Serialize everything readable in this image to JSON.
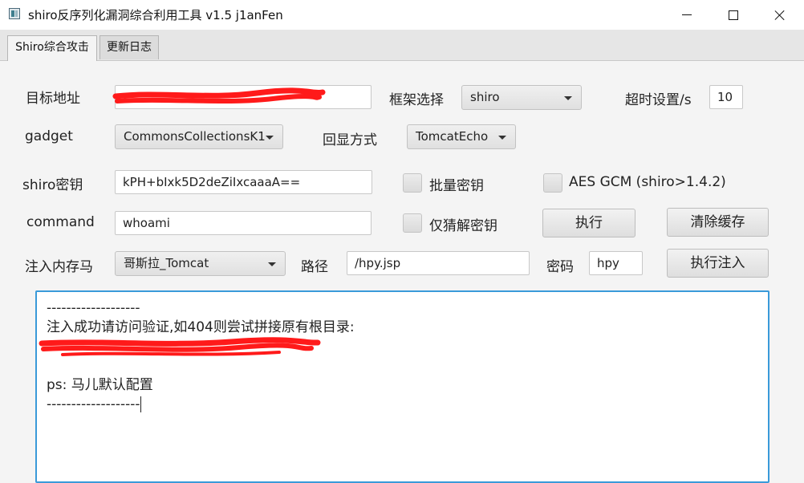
{
  "window": {
    "title": "shiro反序列化漏洞综合利用工具 v1.5  j1anFen",
    "icon": "app-icon"
  },
  "tabs": [
    {
      "label": "Shiro综合攻击",
      "active": true
    },
    {
      "label": "更新日志",
      "active": false
    }
  ],
  "form": {
    "target": {
      "label": "目标地址",
      "value": ""
    },
    "framework": {
      "label": "框架选择",
      "selected": "shiro"
    },
    "timeout": {
      "label": "超时设置/s",
      "value": "10"
    },
    "gadget": {
      "label": "gadget",
      "selected": "CommonsCollectionsK1"
    },
    "echo": {
      "label": "回显方式",
      "selected": "TomcatEcho"
    },
    "key": {
      "label": "shiro密钥",
      "value": "kPH+bIxk5D2deZiIxcaaaA=="
    },
    "batch_key": {
      "label": "批量密钥",
      "checked": false
    },
    "aes_gcm": {
      "label": "AES GCM (shiro>1.4.2)",
      "checked": false
    },
    "command": {
      "label": "command",
      "value": "whoami"
    },
    "guess_key_only": {
      "label": "仅猜解密钥",
      "checked": false
    },
    "execute_label": "执行",
    "clear_cache_label": "清除缓存",
    "memshell": {
      "label": "注入内存马",
      "selected": "哥斯拉_Tomcat"
    },
    "path": {
      "label": "路径",
      "value": "/hpy.jsp"
    },
    "password": {
      "label": "密码",
      "value": "hpy"
    },
    "inject_label": "执行注入"
  },
  "output": {
    "lines": [
      "-------------------",
      "注入成功请访问验证,如404则尝试拼接原有根目录:",
      "",
      "",
      "ps: 马儿默认配置",
      "-------------------"
    ]
  },
  "colors": {
    "focus_border": "#3a9ad9",
    "redaction": "#ff1a1a"
  }
}
